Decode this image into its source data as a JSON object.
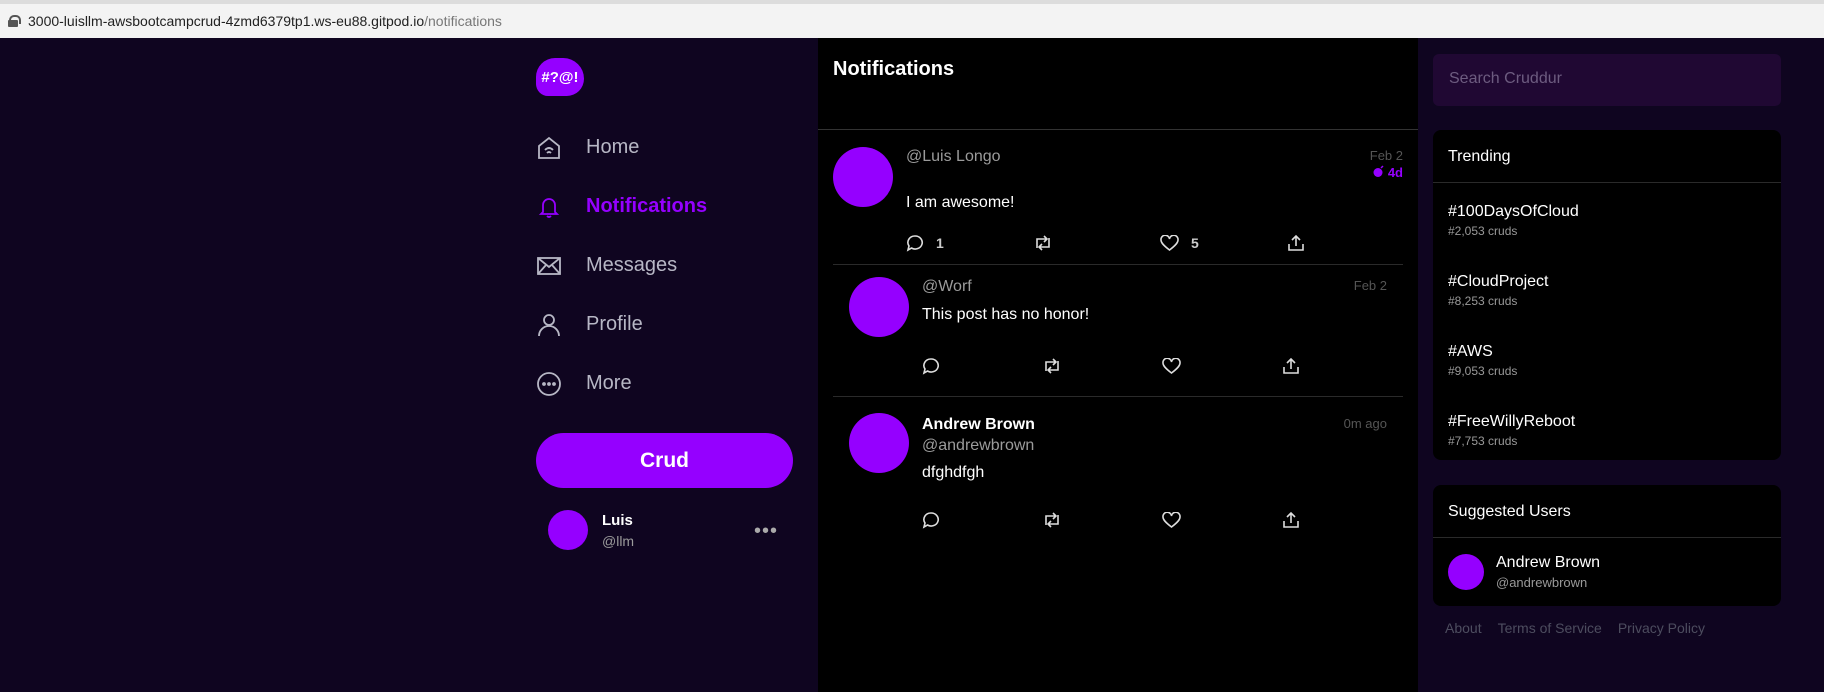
{
  "browser": {
    "url_host": "3000-luisllm-awsbootcampcrud-4zmd6379tp1.ws-eu88.gitpod.io",
    "url_path": "/notifications"
  },
  "nav": {
    "logo_text": "#?@!",
    "items": [
      {
        "label": "Home",
        "icon": "home-icon"
      },
      {
        "label": "Notifications",
        "icon": "bell-icon",
        "active": true
      },
      {
        "label": "Messages",
        "icon": "envelope-icon"
      },
      {
        "label": "Profile",
        "icon": "person-icon"
      },
      {
        "label": "More",
        "icon": "more-circle-icon"
      }
    ],
    "crud_button": "Crud",
    "user": {
      "name": "Luis",
      "handle": "@llm"
    }
  },
  "feed": {
    "title": "Notifications",
    "posts": [
      {
        "handle": "@Luis Longo",
        "message": "I am awesome!",
        "date": "Feb 2",
        "expires": "4d",
        "replies": "1",
        "likes": "5"
      },
      {
        "handle": "@Worf",
        "message": "This post has no honor!",
        "date": "Feb 2"
      },
      {
        "name": "Andrew Brown",
        "handle": "@andrewbrown",
        "message": "dfghdfgh",
        "date": "0m ago"
      }
    ]
  },
  "right": {
    "search_placeholder": "Search Cruddur",
    "trending_title": "Trending",
    "trends": [
      {
        "tag": "#100DaysOfCloud",
        "count": "#2,053 cruds"
      },
      {
        "tag": "#CloudProject",
        "count": "#8,253 cruds"
      },
      {
        "tag": "#AWS",
        "count": "#9,053 cruds"
      },
      {
        "tag": "#FreeWillyReboot",
        "count": "#7,753 cruds"
      }
    ],
    "suggested_title": "Suggested Users",
    "suggested": [
      {
        "name": "Andrew Brown",
        "handle": "@andrewbrown"
      }
    ],
    "footer": [
      "About",
      "Terms of Service",
      "Privacy Policy"
    ]
  },
  "colors": {
    "accent": "#9500ff",
    "bg": "#0f0520",
    "panel": "#000000"
  }
}
